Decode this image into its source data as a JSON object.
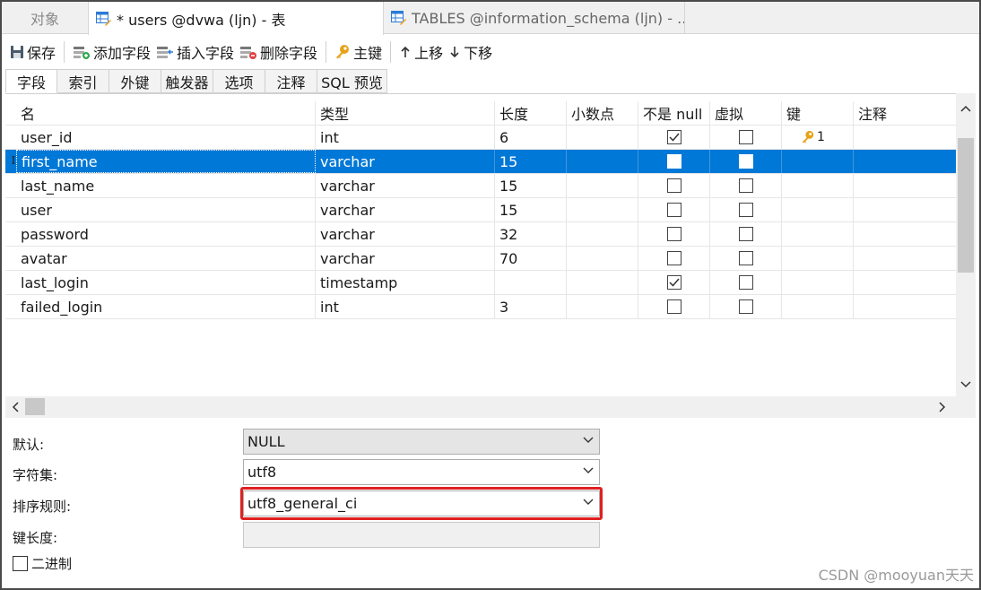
{
  "window_tabs": [
    {
      "label": "对象"
    },
    {
      "label": "* users @dvwa (ljn) - 表"
    },
    {
      "label": "TABLES @information_schema (ljn) - ..."
    }
  ],
  "toolbar": {
    "save": "保存",
    "add_field": "添加字段",
    "insert_field": "插入字段",
    "delete_field": "删除字段",
    "primary_key": "主键",
    "move_up": "上移",
    "move_down": "下移"
  },
  "sub_tabs": [
    "字段",
    "索引",
    "外键",
    "触发器",
    "选项",
    "注释",
    "SQL 预览"
  ],
  "grid": {
    "headers": {
      "name": "名",
      "type": "类型",
      "length": "长度",
      "decimals": "小数点",
      "not_null": "不是 null",
      "virtual": "虚拟",
      "key": "键",
      "comment": "注释"
    },
    "rows": [
      {
        "name": "user_id",
        "type": "int",
        "length": "6",
        "not_null": true,
        "virtual": false,
        "key": "1"
      },
      {
        "name": "first_name",
        "type": "varchar",
        "length": "15",
        "not_null": false,
        "virtual": false,
        "key": "",
        "selected": true
      },
      {
        "name": "last_name",
        "type": "varchar",
        "length": "15",
        "not_null": false,
        "virtual": false,
        "key": ""
      },
      {
        "name": "user",
        "type": "varchar",
        "length": "15",
        "not_null": false,
        "virtual": false,
        "key": ""
      },
      {
        "name": "password",
        "type": "varchar",
        "length": "32",
        "not_null": false,
        "virtual": false,
        "key": ""
      },
      {
        "name": "avatar",
        "type": "varchar",
        "length": "70",
        "not_null": false,
        "virtual": false,
        "key": ""
      },
      {
        "name": "last_login",
        "type": "timestamp",
        "length": "",
        "not_null": true,
        "virtual": false,
        "key": ""
      },
      {
        "name": "failed_login",
        "type": "int",
        "length": "3",
        "not_null": false,
        "virtual": false,
        "key": ""
      }
    ],
    "row_marker": "I"
  },
  "properties": {
    "default_label": "默认:",
    "default_value": "NULL",
    "charset_label": "字符集:",
    "charset_value": "utf8",
    "collation_label": "排序规则:",
    "collation_value": "utf8_general_ci",
    "key_length_label": "键长度:",
    "key_length_value": "",
    "binary_label": "二进制",
    "binary_checked": false
  },
  "watermark": "CSDN @mooyuan天天",
  "colors": {
    "selection": "#0078d7",
    "highlight_box": "#e02020",
    "key_icon": "#e8a21a"
  }
}
